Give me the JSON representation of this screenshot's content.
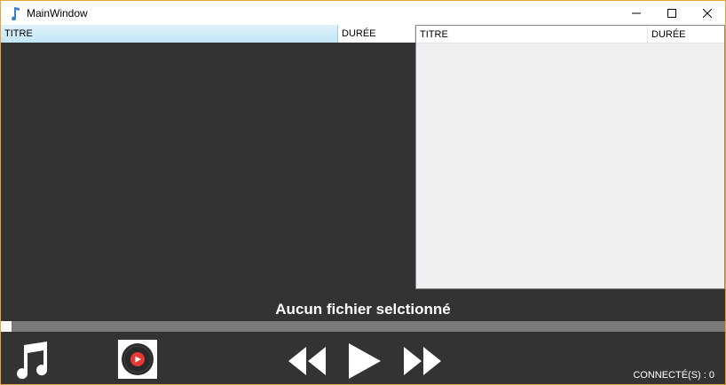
{
  "window": {
    "title": "MainWindow"
  },
  "left_table": {
    "columns": [
      "TITRE",
      "DURÉE"
    ],
    "rows": []
  },
  "right_table": {
    "columns": [
      "TITRE",
      "DURÉE"
    ],
    "rows": []
  },
  "player": {
    "status": "Aucun fichier selctionné",
    "progress": 0.015,
    "connected_label": "CONNECTÉ(S) : 0"
  },
  "icons": {
    "app": "music-note-icon",
    "minimize": "minimize-icon",
    "maximize": "maximize-icon",
    "close": "close-icon",
    "music": "music-notes-icon",
    "disc": "vinyl-disc-icon",
    "rewind": "rewind-icon",
    "play": "play-icon",
    "fast_forward": "fast-forward-icon"
  },
  "colors": {
    "background": "#333333",
    "window_border": "#e8a33c",
    "selected_header": "#c3e6f6",
    "disc_center": "#e53935"
  }
}
